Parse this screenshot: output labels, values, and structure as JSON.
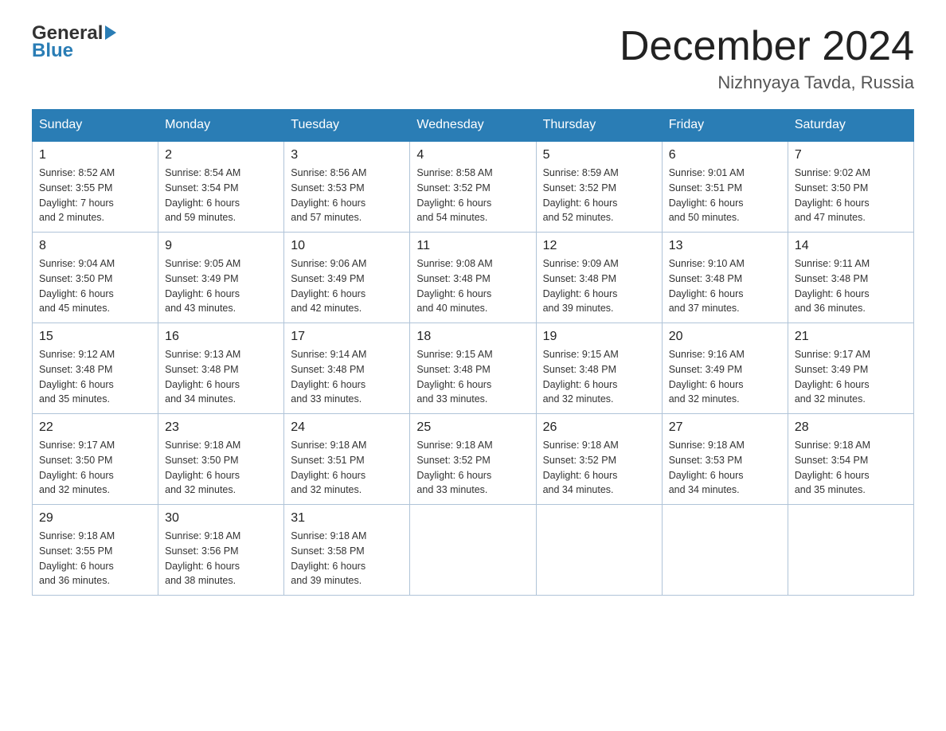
{
  "logo": {
    "line1": "General",
    "line2": "Blue"
  },
  "title": "December 2024",
  "location": "Nizhnyaya Tavda, Russia",
  "days_header": [
    "Sunday",
    "Monday",
    "Tuesday",
    "Wednesday",
    "Thursday",
    "Friday",
    "Saturday"
  ],
  "weeks": [
    [
      {
        "day": "1",
        "info": "Sunrise: 8:52 AM\nSunset: 3:55 PM\nDaylight: 7 hours\nand 2 minutes."
      },
      {
        "day": "2",
        "info": "Sunrise: 8:54 AM\nSunset: 3:54 PM\nDaylight: 6 hours\nand 59 minutes."
      },
      {
        "day": "3",
        "info": "Sunrise: 8:56 AM\nSunset: 3:53 PM\nDaylight: 6 hours\nand 57 minutes."
      },
      {
        "day": "4",
        "info": "Sunrise: 8:58 AM\nSunset: 3:52 PM\nDaylight: 6 hours\nand 54 minutes."
      },
      {
        "day": "5",
        "info": "Sunrise: 8:59 AM\nSunset: 3:52 PM\nDaylight: 6 hours\nand 52 minutes."
      },
      {
        "day": "6",
        "info": "Sunrise: 9:01 AM\nSunset: 3:51 PM\nDaylight: 6 hours\nand 50 minutes."
      },
      {
        "day": "7",
        "info": "Sunrise: 9:02 AM\nSunset: 3:50 PM\nDaylight: 6 hours\nand 47 minutes."
      }
    ],
    [
      {
        "day": "8",
        "info": "Sunrise: 9:04 AM\nSunset: 3:50 PM\nDaylight: 6 hours\nand 45 minutes."
      },
      {
        "day": "9",
        "info": "Sunrise: 9:05 AM\nSunset: 3:49 PM\nDaylight: 6 hours\nand 43 minutes."
      },
      {
        "day": "10",
        "info": "Sunrise: 9:06 AM\nSunset: 3:49 PM\nDaylight: 6 hours\nand 42 minutes."
      },
      {
        "day": "11",
        "info": "Sunrise: 9:08 AM\nSunset: 3:48 PM\nDaylight: 6 hours\nand 40 minutes."
      },
      {
        "day": "12",
        "info": "Sunrise: 9:09 AM\nSunset: 3:48 PM\nDaylight: 6 hours\nand 39 minutes."
      },
      {
        "day": "13",
        "info": "Sunrise: 9:10 AM\nSunset: 3:48 PM\nDaylight: 6 hours\nand 37 minutes."
      },
      {
        "day": "14",
        "info": "Sunrise: 9:11 AM\nSunset: 3:48 PM\nDaylight: 6 hours\nand 36 minutes."
      }
    ],
    [
      {
        "day": "15",
        "info": "Sunrise: 9:12 AM\nSunset: 3:48 PM\nDaylight: 6 hours\nand 35 minutes."
      },
      {
        "day": "16",
        "info": "Sunrise: 9:13 AM\nSunset: 3:48 PM\nDaylight: 6 hours\nand 34 minutes."
      },
      {
        "day": "17",
        "info": "Sunrise: 9:14 AM\nSunset: 3:48 PM\nDaylight: 6 hours\nand 33 minutes."
      },
      {
        "day": "18",
        "info": "Sunrise: 9:15 AM\nSunset: 3:48 PM\nDaylight: 6 hours\nand 33 minutes."
      },
      {
        "day": "19",
        "info": "Sunrise: 9:15 AM\nSunset: 3:48 PM\nDaylight: 6 hours\nand 32 minutes."
      },
      {
        "day": "20",
        "info": "Sunrise: 9:16 AM\nSunset: 3:49 PM\nDaylight: 6 hours\nand 32 minutes."
      },
      {
        "day": "21",
        "info": "Sunrise: 9:17 AM\nSunset: 3:49 PM\nDaylight: 6 hours\nand 32 minutes."
      }
    ],
    [
      {
        "day": "22",
        "info": "Sunrise: 9:17 AM\nSunset: 3:50 PM\nDaylight: 6 hours\nand 32 minutes."
      },
      {
        "day": "23",
        "info": "Sunrise: 9:18 AM\nSunset: 3:50 PM\nDaylight: 6 hours\nand 32 minutes."
      },
      {
        "day": "24",
        "info": "Sunrise: 9:18 AM\nSunset: 3:51 PM\nDaylight: 6 hours\nand 32 minutes."
      },
      {
        "day": "25",
        "info": "Sunrise: 9:18 AM\nSunset: 3:52 PM\nDaylight: 6 hours\nand 33 minutes."
      },
      {
        "day": "26",
        "info": "Sunrise: 9:18 AM\nSunset: 3:52 PM\nDaylight: 6 hours\nand 34 minutes."
      },
      {
        "day": "27",
        "info": "Sunrise: 9:18 AM\nSunset: 3:53 PM\nDaylight: 6 hours\nand 34 minutes."
      },
      {
        "day": "28",
        "info": "Sunrise: 9:18 AM\nSunset: 3:54 PM\nDaylight: 6 hours\nand 35 minutes."
      }
    ],
    [
      {
        "day": "29",
        "info": "Sunrise: 9:18 AM\nSunset: 3:55 PM\nDaylight: 6 hours\nand 36 minutes."
      },
      {
        "day": "30",
        "info": "Sunrise: 9:18 AM\nSunset: 3:56 PM\nDaylight: 6 hours\nand 38 minutes."
      },
      {
        "day": "31",
        "info": "Sunrise: 9:18 AM\nSunset: 3:58 PM\nDaylight: 6 hours\nand 39 minutes."
      },
      {
        "day": "",
        "info": ""
      },
      {
        "day": "",
        "info": ""
      },
      {
        "day": "",
        "info": ""
      },
      {
        "day": "",
        "info": ""
      }
    ]
  ]
}
